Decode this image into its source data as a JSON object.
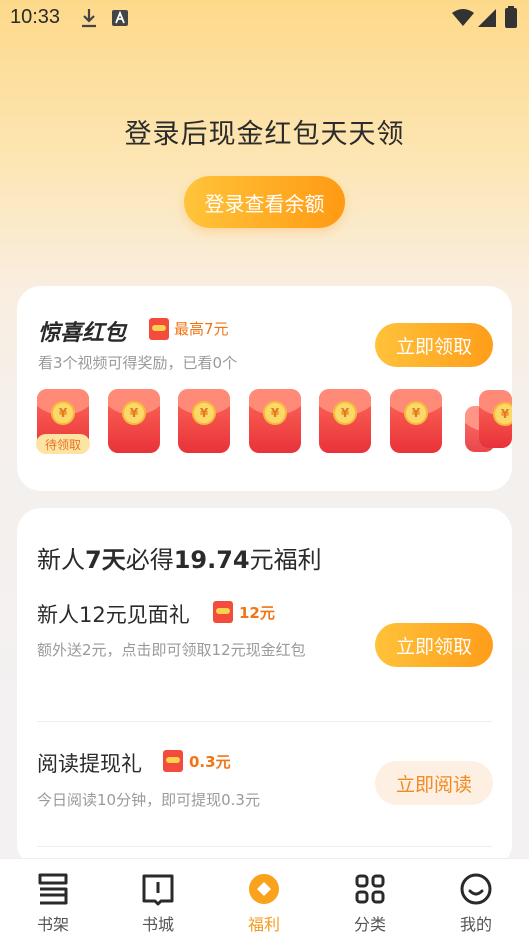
{
  "status_bar": {
    "time": "10:33"
  },
  "hero": {
    "title": "登录后现金红包天天领",
    "button": "登录查看余额"
  },
  "surprise": {
    "title": "惊喜红包",
    "max_label": "最高7元",
    "subtitle": "看3个视频可得奖励，已看0个",
    "claim_button": "立即领取",
    "pending_tag": "待领取",
    "coin_symbol": "¥"
  },
  "newbie": {
    "title_prefix": "新人",
    "title_days": "7天",
    "title_mid": "必得",
    "title_amount": "19.74",
    "title_suffix": "元福利",
    "items": [
      {
        "title": "新人12元见面礼",
        "badge": "12元",
        "desc": "额外送2元，点击即可领取12元现金红包",
        "button": "立即领取"
      },
      {
        "title": "阅读提现礼",
        "badge": "0.3元",
        "desc": "今日阅读10分钟，即可提现0.3元",
        "button": "立即阅读"
      }
    ]
  },
  "tabs": [
    {
      "label": "书架",
      "icon": "bookshelf-icon"
    },
    {
      "label": "书城",
      "icon": "book-icon"
    },
    {
      "label": "福利",
      "icon": "welfare-icon"
    },
    {
      "label": "分类",
      "icon": "category-icon"
    },
    {
      "label": "我的",
      "icon": "profile-icon"
    }
  ],
  "colors": {
    "accent": "#ff9d1a",
    "active_tab": "#f59a1e"
  }
}
